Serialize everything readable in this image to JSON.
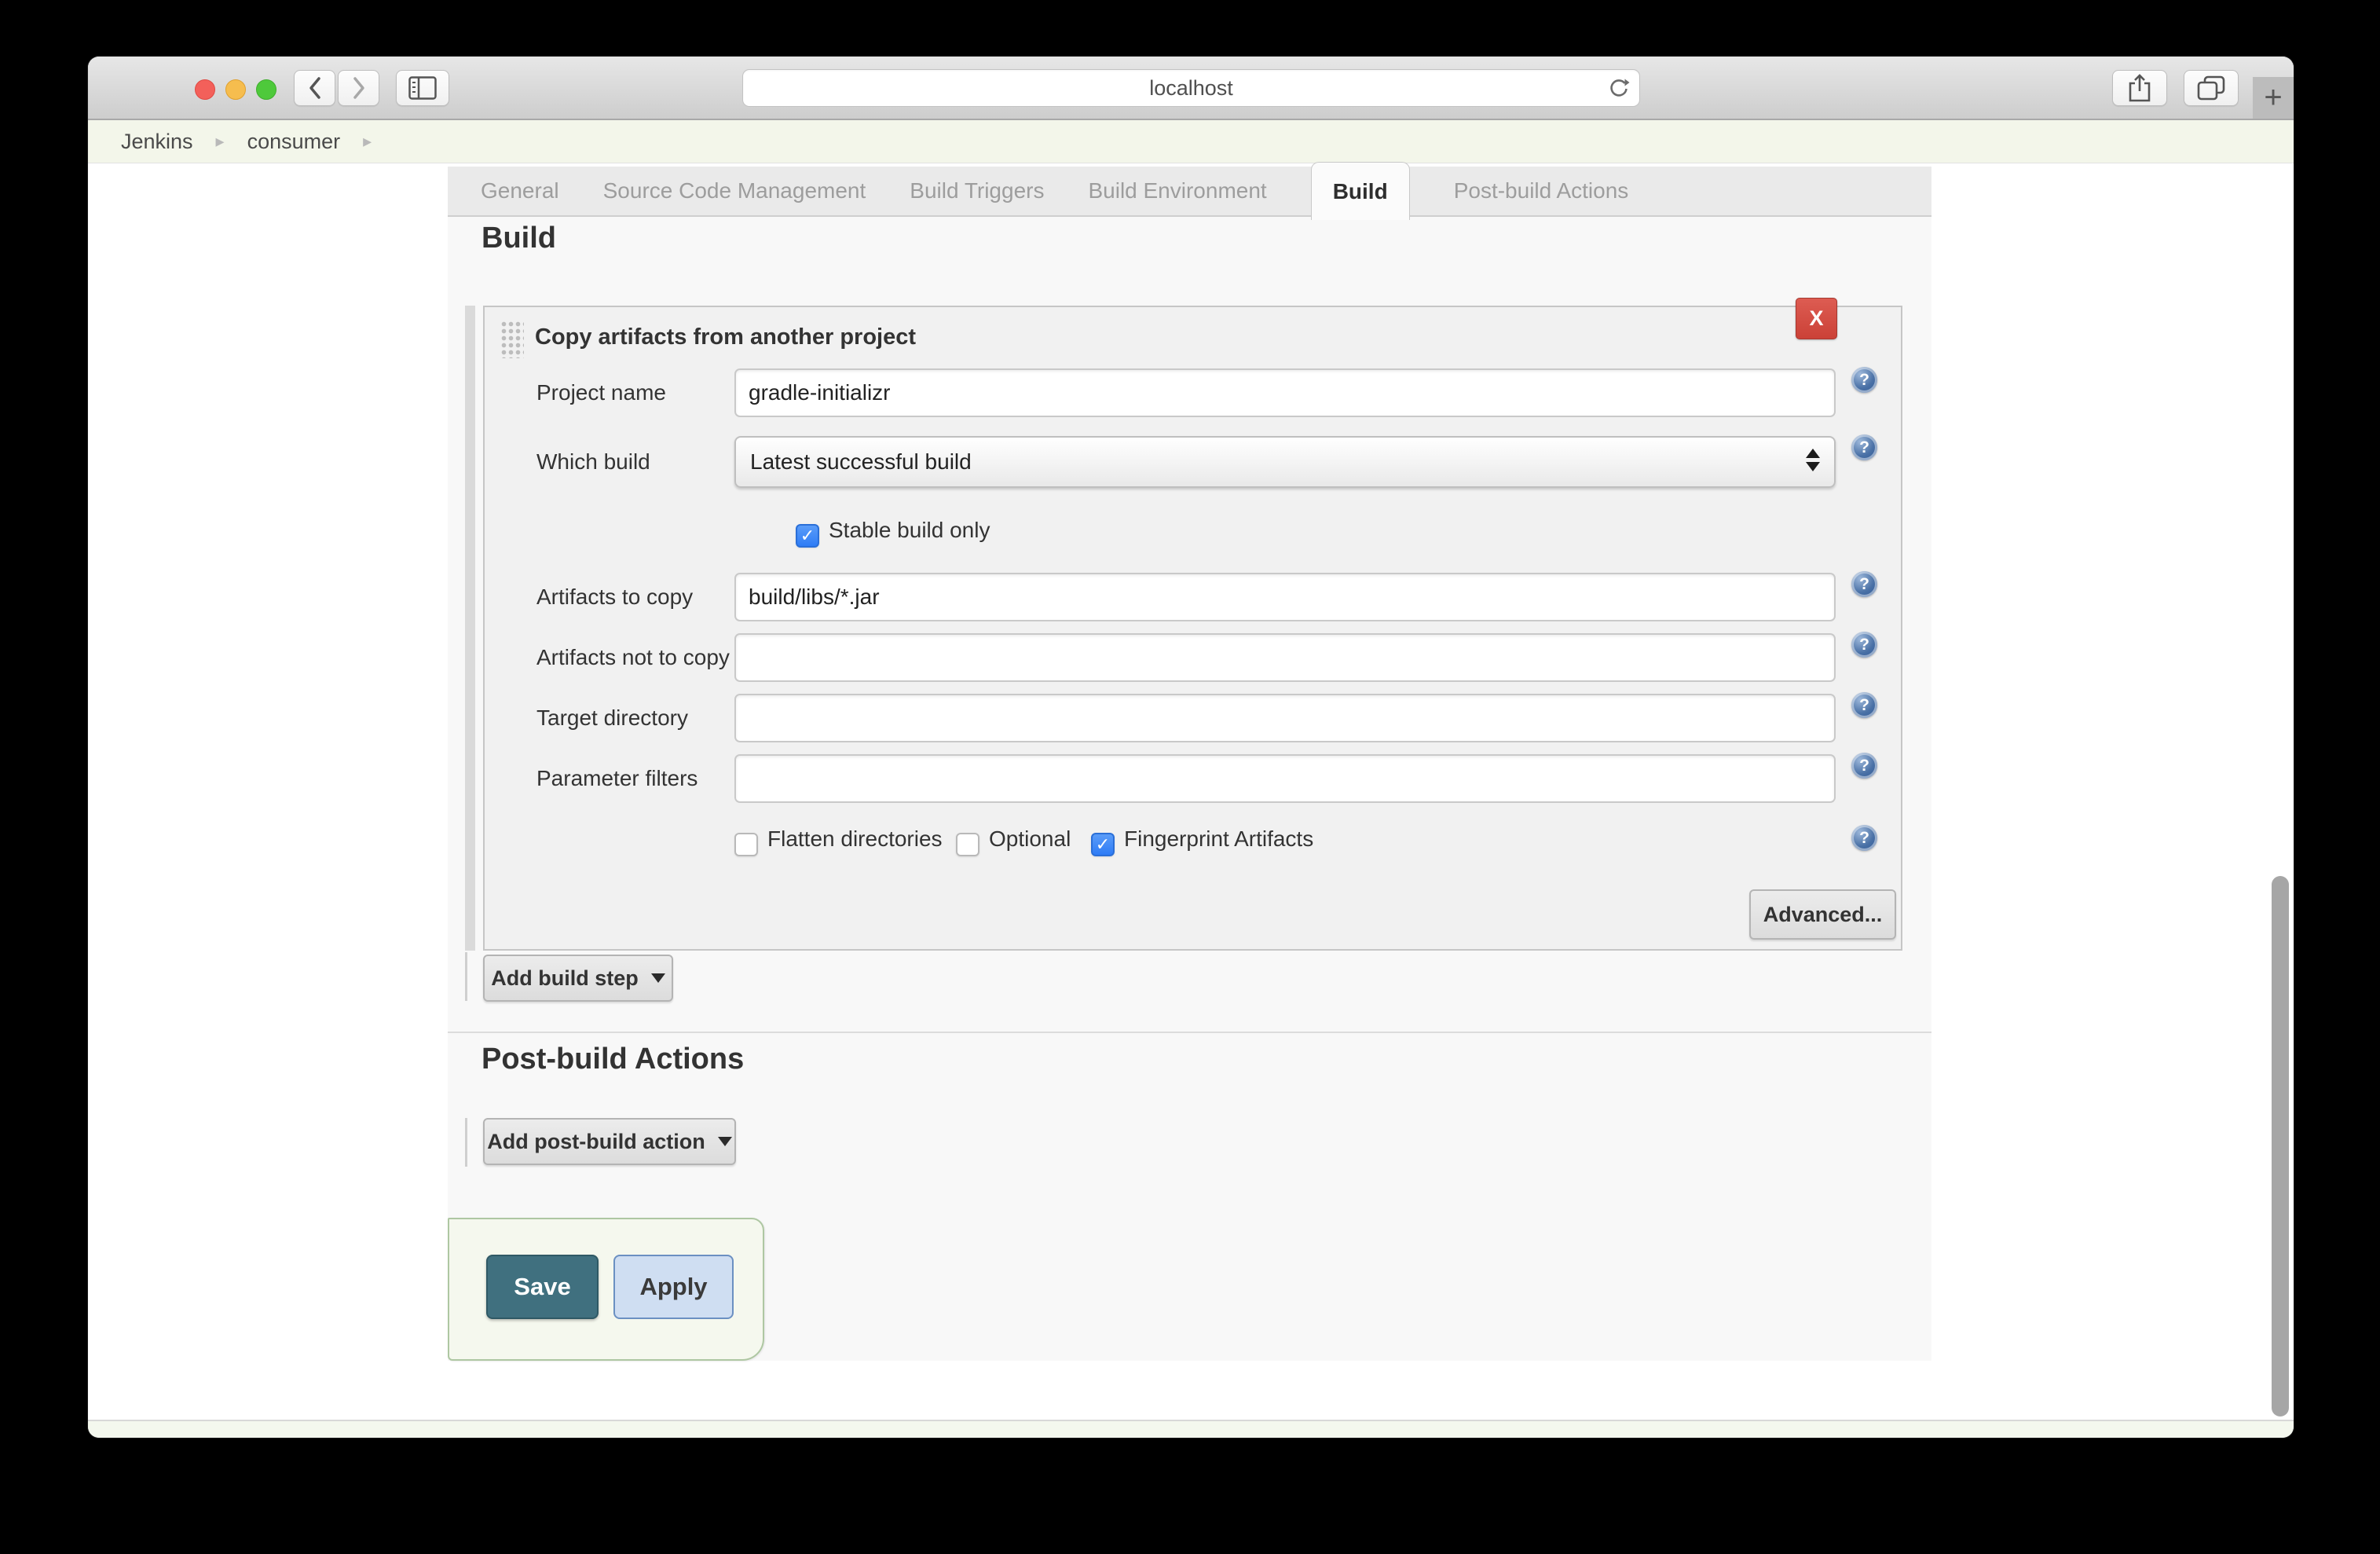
{
  "window": {
    "url": "localhost"
  },
  "icons": {
    "back": "‹",
    "forward": "›",
    "plus": "+",
    "check": "✓",
    "question": "?",
    "chevron_sep": "▸"
  },
  "breadcrumb": {
    "items": [
      "Jenkins",
      "consumer"
    ]
  },
  "tabs": {
    "active": "Build",
    "items": [
      {
        "label": "General"
      },
      {
        "label": "Source Code Management"
      },
      {
        "label": "Build Triggers"
      },
      {
        "label": "Build Environment"
      },
      {
        "label": "Build"
      },
      {
        "label": "Post-build Actions"
      }
    ]
  },
  "build_section": {
    "heading": "Build",
    "step": {
      "title": "Copy artifacts from another project",
      "delete_label": "X",
      "fields": [
        {
          "label": "Project name",
          "value": "gradle-initializr"
        },
        {
          "label": "Which build",
          "value": "Latest successful build"
        },
        {
          "label": "Artifacts to copy",
          "value": "build/libs/*.jar"
        },
        {
          "label": "Artifacts not to copy",
          "value": ""
        },
        {
          "label": "Target directory",
          "value": ""
        },
        {
          "label": "Parameter filters",
          "value": ""
        }
      ],
      "stable_build_only": {
        "label": "Stable build only",
        "checked": true
      },
      "options": [
        {
          "label": "Flatten directories",
          "checked": false
        },
        {
          "label": "Optional",
          "checked": false
        },
        {
          "label": "Fingerprint Artifacts",
          "checked": true
        }
      ],
      "advanced_label": "Advanced..."
    },
    "add_build_step_label": "Add build step"
  },
  "postbuild_section": {
    "heading": "Post-build Actions",
    "add_action_label": "Add post-build action"
  },
  "actions": {
    "save": "Save",
    "apply": "Apply"
  },
  "colors": {
    "delete_red": "#d9534f",
    "save_teal": "#40707f",
    "apply_blue": "#cfdef2",
    "checkbox_blue": "#2e7cf6",
    "help_blue": "#2d5694",
    "breadcrumb_bg": "#f3f6ea"
  }
}
